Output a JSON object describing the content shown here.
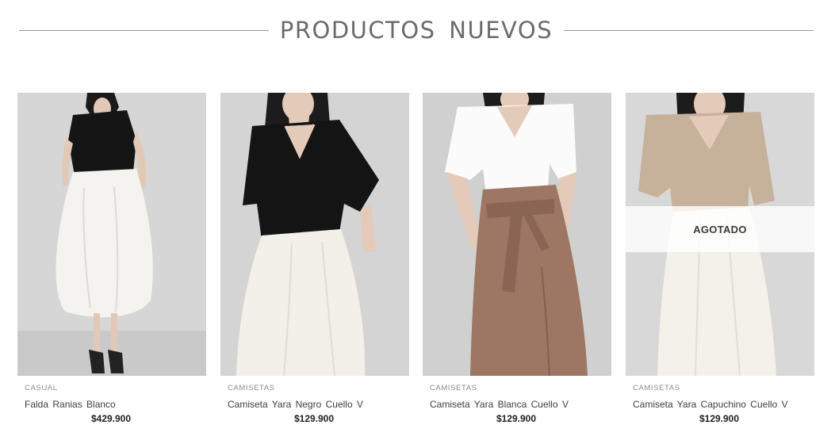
{
  "section": {
    "title": "PRODUCTOS NUEVOS"
  },
  "products": [
    {
      "category": "CASUAL",
      "name": "Falda Ranias Blanco",
      "price": "$429.900",
      "sold_out": false
    },
    {
      "category": "CAMISETAS",
      "name": "Camiseta Yara Negro Cuello V",
      "price": "$129.900",
      "sold_out": false
    },
    {
      "category": "CAMISETAS",
      "name": "Camiseta Yara Blanca Cuello V",
      "price": "$129.900",
      "sold_out": false
    },
    {
      "category": "CAMISETAS",
      "name": "Camiseta Yara Capuchino Cuello V",
      "price": "$129.900",
      "sold_out": true,
      "badge": "AGOTADO"
    }
  ],
  "colors": {
    "photo_bg": "#d2d2d2",
    "black_top": "#151515",
    "white_skirt": "#f4f2ee",
    "brown_skirt": "#9c7563",
    "beige_top": "#c5b19c"
  }
}
